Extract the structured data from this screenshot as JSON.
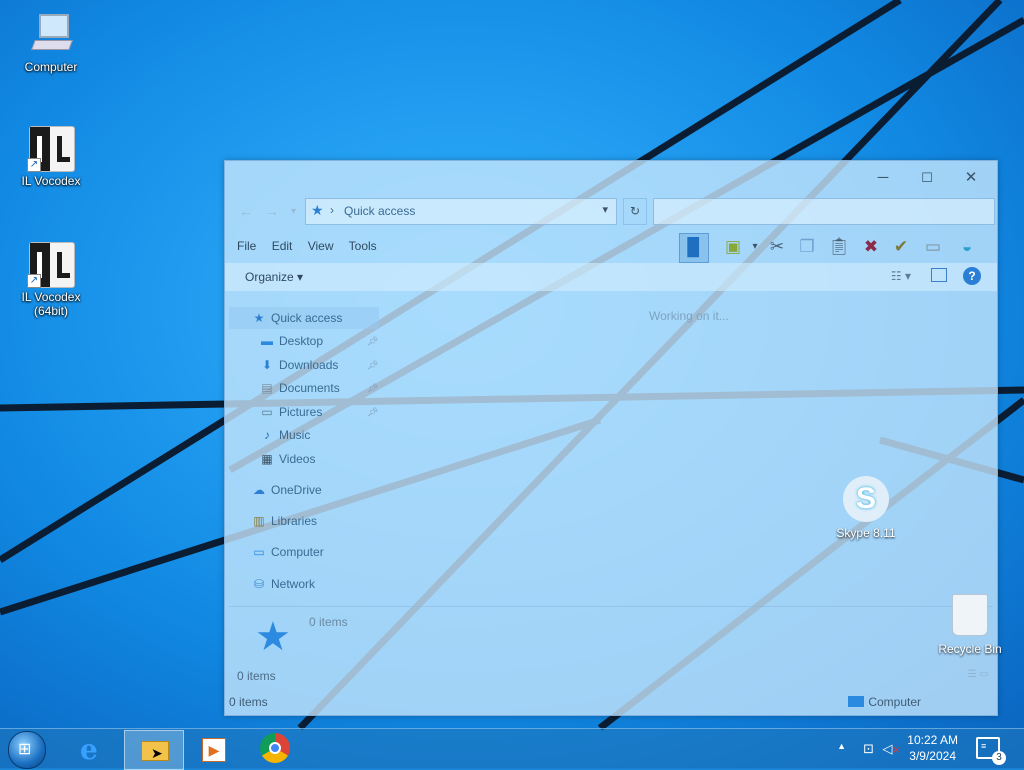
{
  "desktop": {
    "icons": [
      {
        "label": "Computer",
        "icon": "computer-icon"
      },
      {
        "label": "IL Vocodex",
        "icon": "il-vocodex-icon"
      },
      {
        "label": "IL Vocodex (64bit)",
        "icon": "il-vocodex-icon"
      },
      {
        "label": "Skype 8.11",
        "icon": "skype-icon"
      },
      {
        "label": "Recycle Bin",
        "icon": "recycle-bin-icon"
      }
    ]
  },
  "explorer": {
    "caption": {
      "minimize": "─",
      "maximize": "☐",
      "close": "✕"
    },
    "address": {
      "location": "Quick access",
      "separator": "›"
    },
    "menu": [
      "File",
      "Edit",
      "View",
      "Tools"
    ],
    "organize_label": "Organize ▾",
    "nav": {
      "quick_access": "Quick access",
      "desktop": "Desktop",
      "downloads": "Downloads",
      "documents": "Documents",
      "pictures": "Pictures",
      "music": "Music",
      "videos": "Videos",
      "onedrive": "OneDrive",
      "libraries": "Libraries",
      "computer": "Computer",
      "network": "Network"
    },
    "content_message": "Working on it...",
    "details_count": "0 items",
    "status_items": "0 items",
    "bottom_status": "0 items",
    "bottom_location": "Computer"
  },
  "taskbar": {
    "clock_time": "10:22 AM",
    "clock_date": "3/9/2024",
    "notification_count": "3"
  },
  "colors": {
    "wallpaper": "#1389e0",
    "accent": "#2a7fd4"
  }
}
